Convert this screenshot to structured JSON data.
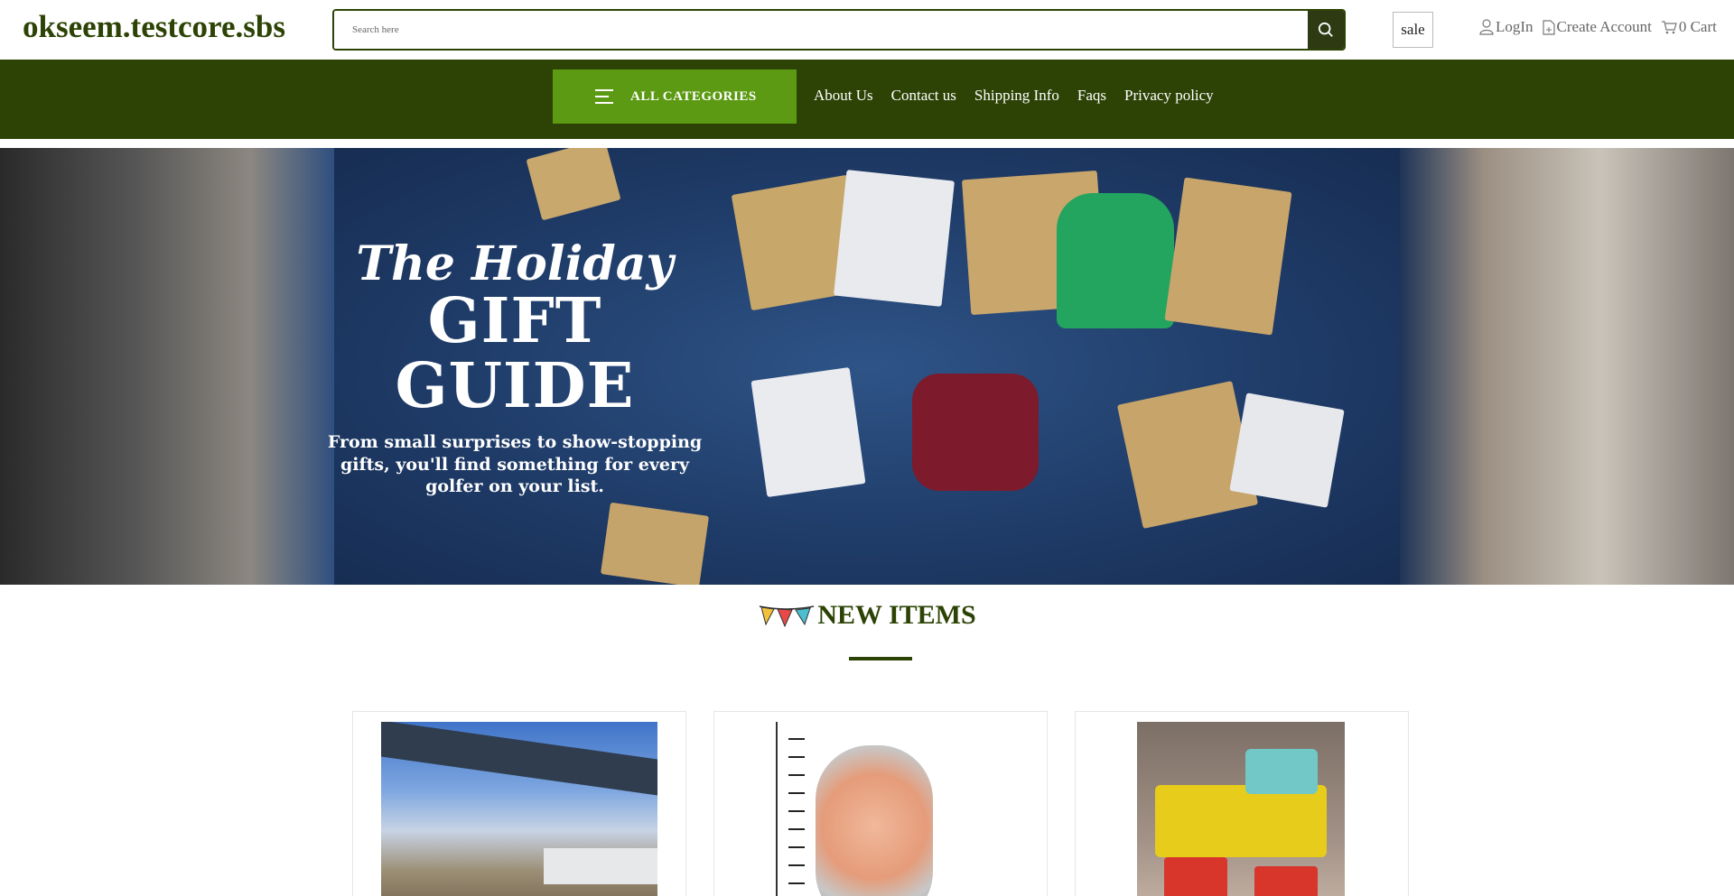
{
  "header": {
    "logo": "okseem.testcore.sbs",
    "search_placeholder": "Search here",
    "sale_label": "sale",
    "login_label": "LogIn",
    "create_account_label": "Create Account",
    "cart_label": "0 Cart"
  },
  "nav": {
    "all_categories_label": "ALL CATEGORIES",
    "links": [
      "About Us",
      "Contact us",
      "Shipping Info",
      "Faqs",
      "Privacy policy"
    ]
  },
  "banner": {
    "script_title": "The Holiday",
    "title": "GIFT GUIDE",
    "subtitle_lines": [
      "From small surprises to show-stopping",
      "gifts, you'll find something for every",
      "golfer on your list."
    ]
  },
  "section": {
    "title": "NEW ITEMS"
  },
  "products": [
    {
      "image_desc": "outdoor-shed-photo"
    },
    {
      "image_desc": "rose-gold-watch-photo"
    },
    {
      "image_desc": "toy-truck-photo"
    }
  ],
  "colors": {
    "brand_dark": "#2d4305",
    "brand_light": "#5b9a12"
  }
}
